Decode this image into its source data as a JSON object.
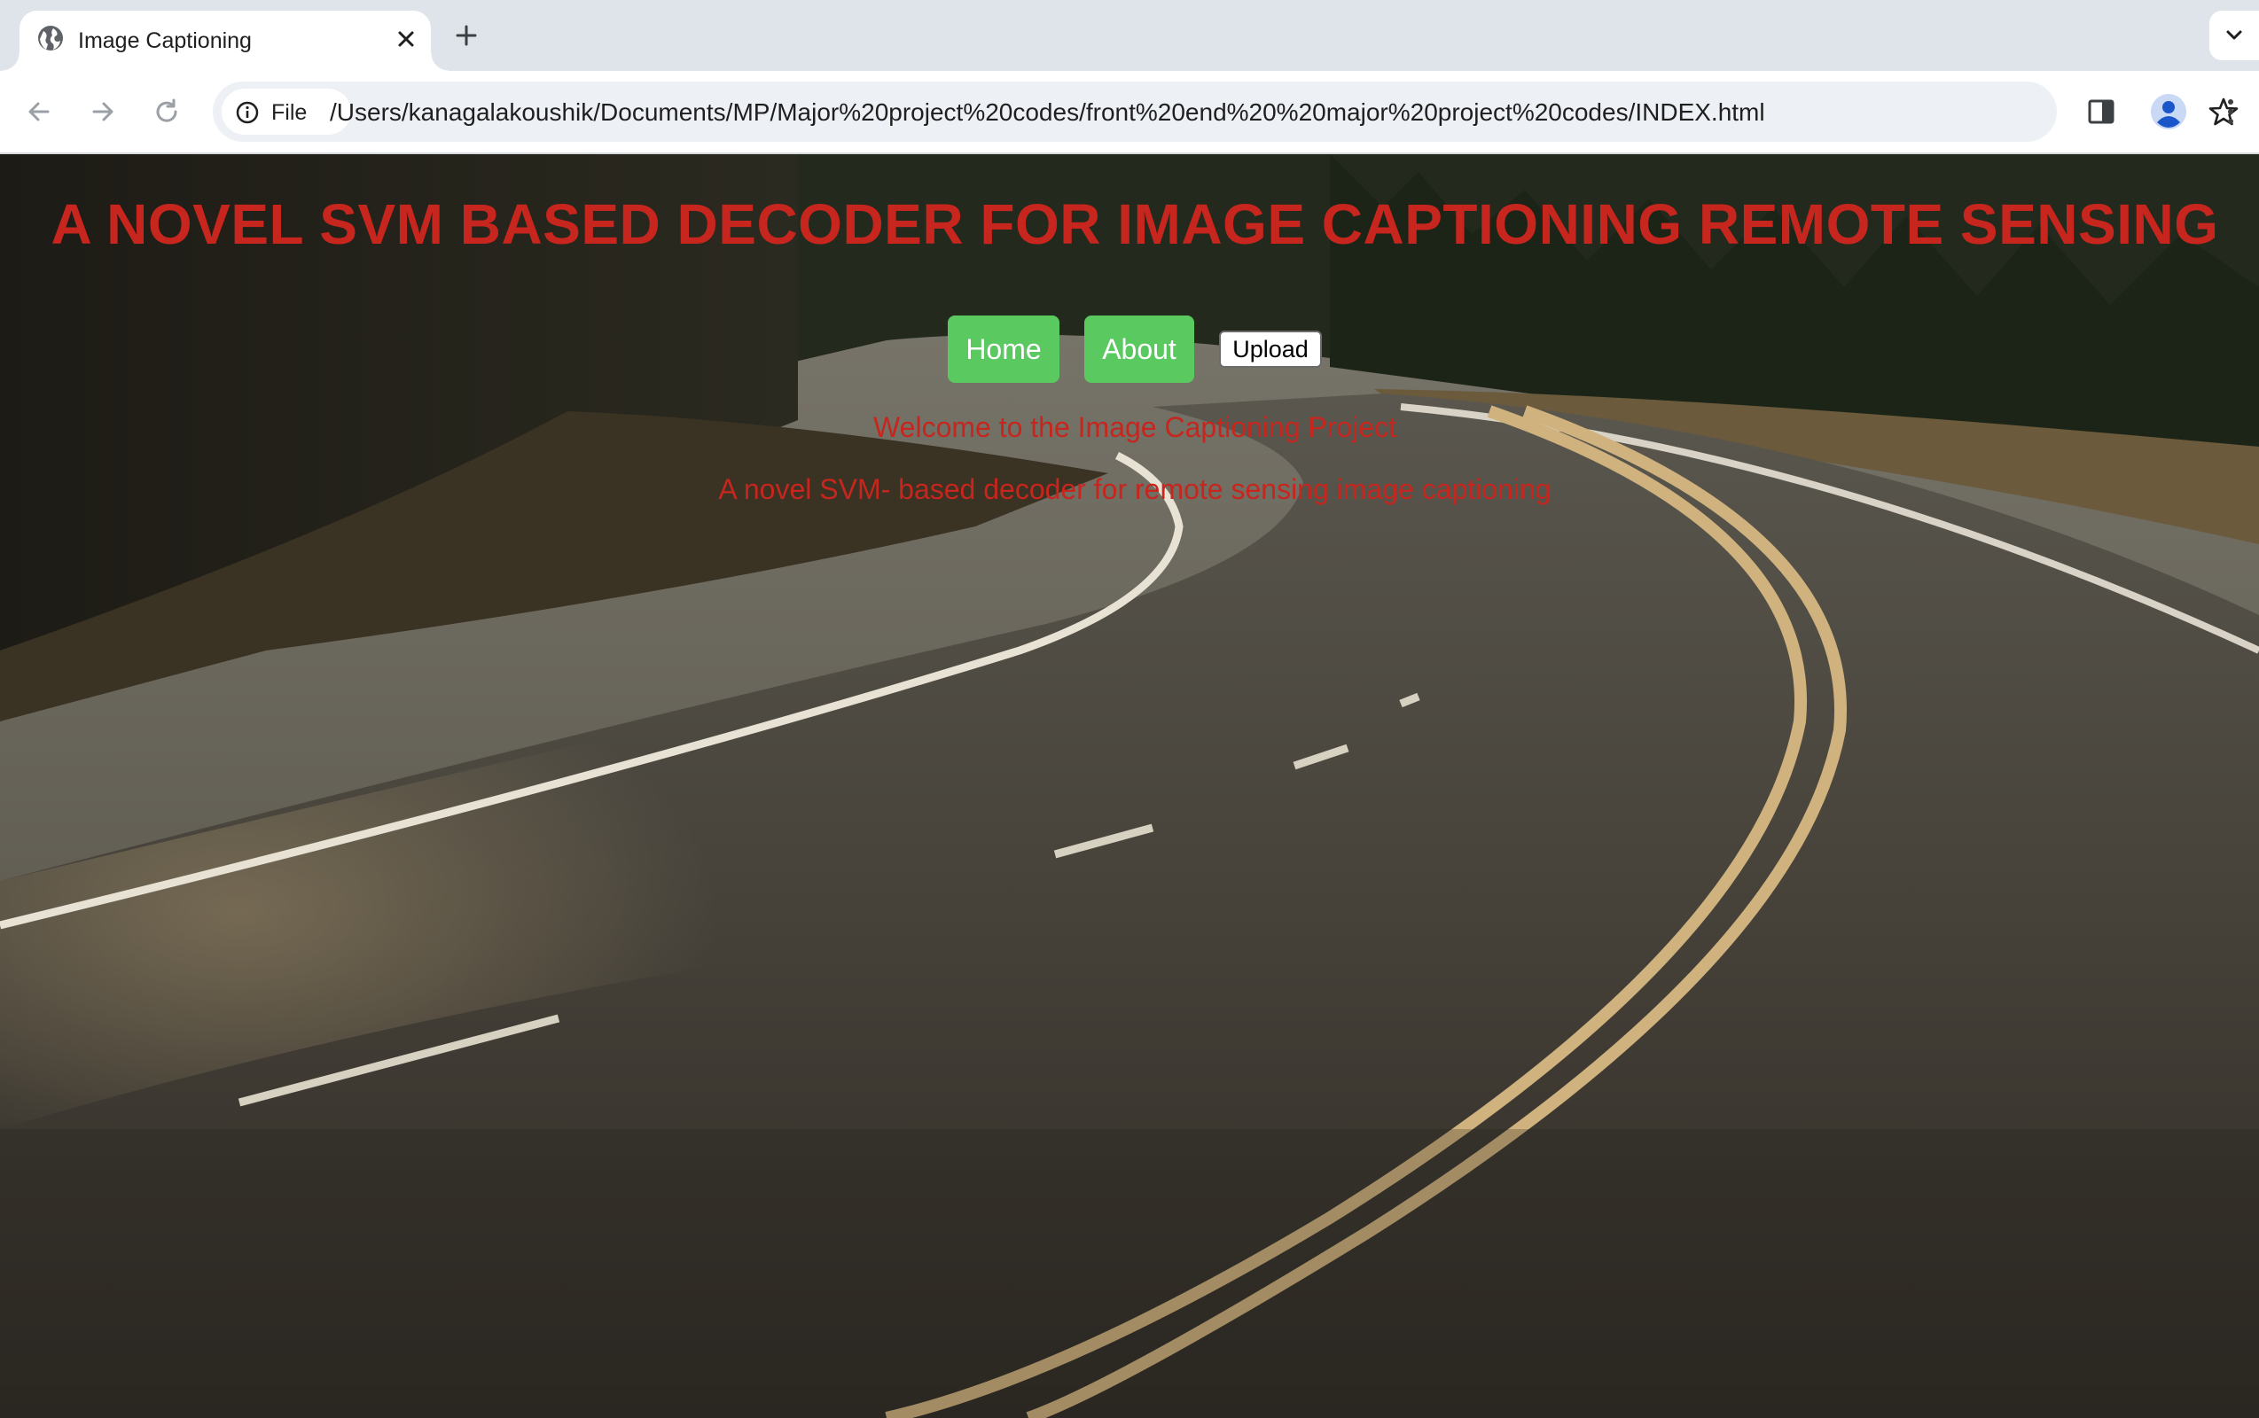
{
  "browser": {
    "tab_title": "Image Captioning",
    "url_scheme_label": "File",
    "url": "/Users/kanagalakoushik/Documents/MP/Major%20project%20codes/front%20end%20%20major%20project%20codes/INDEX.html",
    "icons": [
      "globe-icon",
      "close-icon",
      "plus-icon",
      "chevron-down-icon",
      "back-arrow-icon",
      "forward-arrow-icon",
      "reload-icon",
      "info-icon",
      "star-icon",
      "side-panel-icon",
      "profile-icon",
      "kebab-menu-icon"
    ]
  },
  "page": {
    "title": "A NOVEL SVM BASED DECODER FOR IMAGE CAPTIONING REMOTE SENSING",
    "nav": {
      "home_label": "Home",
      "about_label": "About",
      "upload_label": "Upload"
    },
    "welcome": "Welcome to the Image Captioning Project",
    "subtitle": "A novel SVM- based decoder for remote sensing image captioning",
    "colors": {
      "title": "#c6261d",
      "nav_button": "#5ac95f",
      "nav_text": "#ffffff"
    }
  }
}
